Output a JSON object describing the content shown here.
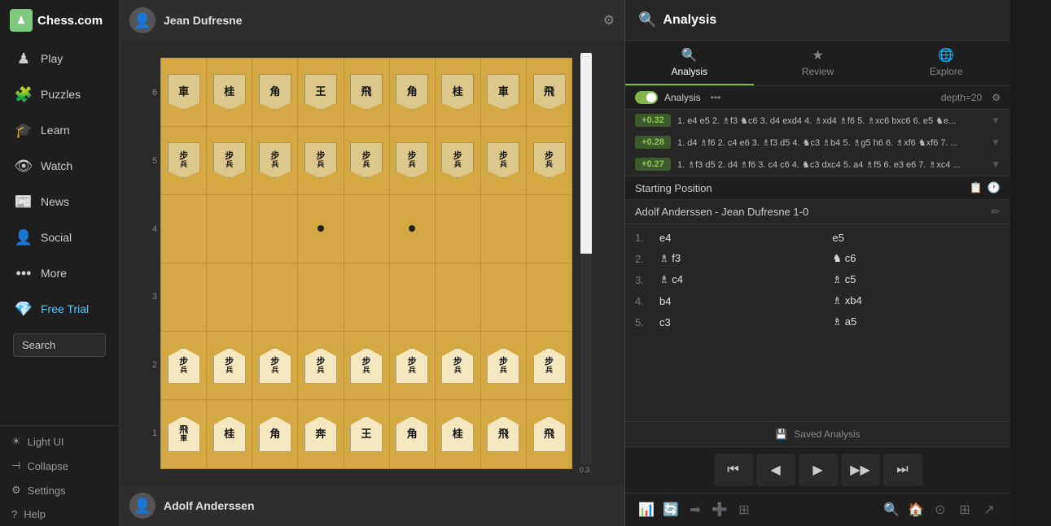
{
  "sidebar": {
    "logo": "Chess.com",
    "nav_items": [
      {
        "id": "play",
        "label": "Play",
        "icon": "♟"
      },
      {
        "id": "puzzles",
        "label": "Puzzles",
        "icon": "🧩"
      },
      {
        "id": "learn",
        "label": "Learn",
        "icon": "🎓"
      },
      {
        "id": "watch",
        "label": "Watch",
        "icon": "👁"
      },
      {
        "id": "news",
        "label": "News",
        "icon": "📰"
      },
      {
        "id": "social",
        "label": "Social",
        "icon": "👤"
      },
      {
        "id": "more",
        "label": "More",
        "icon": "•••"
      },
      {
        "id": "free_trial",
        "label": "Free Trial",
        "icon": "💎"
      }
    ],
    "search_placeholder": "Search",
    "bottom_items": [
      {
        "id": "light_ui",
        "label": "Light UI",
        "icon": "☀"
      },
      {
        "id": "collapse",
        "label": "Collapse",
        "icon": "⊣"
      },
      {
        "id": "settings",
        "label": "Settings",
        "icon": "⚙"
      },
      {
        "id": "help",
        "label": "Help",
        "icon": "?"
      }
    ]
  },
  "board": {
    "player_top": "Jean Dufresne",
    "player_bottom": "Adolf Anderssen"
  },
  "analysis": {
    "title": "Analysis",
    "tabs": [
      {
        "id": "analysis",
        "label": "Analysis",
        "active": true
      },
      {
        "id": "review",
        "label": "Review"
      },
      {
        "id": "explore",
        "label": "Explore"
      }
    ],
    "engine_label": "Analysis",
    "depth_label": "depth=20",
    "eval_lines": [
      {
        "score": "+0.32",
        "moves": "1. e4 e5 2. ♗f3 ♞c6 3. d4 exd4 4. ♗xd4 ♗f6 5. ♗xc6 bxc6 6. e5 ♞e..."
      },
      {
        "score": "+0.28",
        "moves": "1. d4 ♗f6 2. c4 e6 3. ♗f3 d5 4. ♞c3 ♗b4 5. ♗g5 h6 6. ♗xf6 ♞xf6 7. ..."
      },
      {
        "score": "+0.27",
        "moves": "1. ♗f3 d5 2. d4 ♗f6 3. c4 c6 4. ♞c3 dxc4 5. a4 ♗f5 6. e3 e6 7. ♗xc4 ..."
      }
    ],
    "position_label": "Starting Position",
    "game_info": "Adolf Anderssen  -  Jean Dufresne  1-0",
    "moves": [
      {
        "num": "1.",
        "white": "e4",
        "black": "e5"
      },
      {
        "num": "2.",
        "white": "♗ f3",
        "black": "♞ c6"
      },
      {
        "num": "3.",
        "white": "♗ c4",
        "black": "♗ c5"
      },
      {
        "num": "4.",
        "white": "b4",
        "black": "♗ xb4"
      },
      {
        "num": "5.",
        "white": "c3",
        "black": "♗ a5"
      }
    ],
    "saved_analysis_label": "Saved Analysis",
    "controls": {
      "first": "⏮",
      "prev": "◀",
      "play": "▶",
      "next": "▶",
      "last": "⏭"
    },
    "eval_score": "0.3"
  }
}
